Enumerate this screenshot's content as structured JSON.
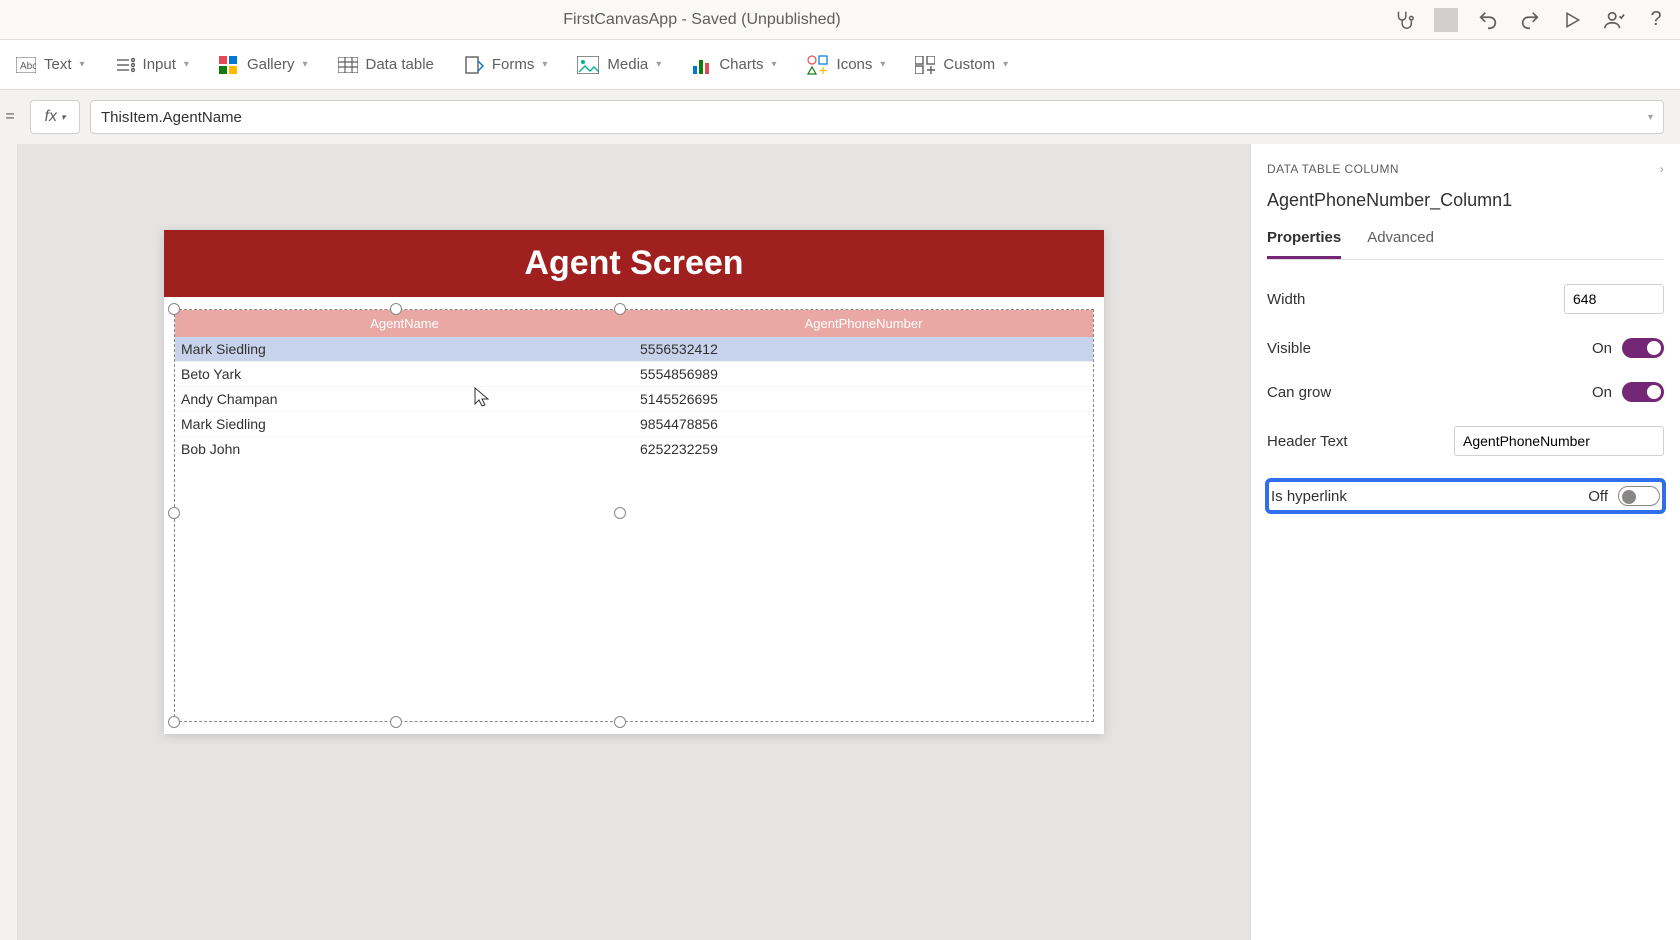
{
  "titlebar": {
    "app_title": "FirstCanvasApp - Saved (Unpublished)"
  },
  "ribbon": {
    "text": "Text",
    "input": "Input",
    "gallery": "Gallery",
    "data_table": "Data table",
    "forms": "Forms",
    "media": "Media",
    "charts": "Charts",
    "icons": "Icons",
    "custom": "Custom"
  },
  "formula": {
    "value": "ThisItem.AgentName"
  },
  "screen": {
    "title": "Agent Screen",
    "col1": "AgentName",
    "col2": "AgentPhoneNumber",
    "rows": [
      {
        "name": "Mark Siedling",
        "phone": "5556532412"
      },
      {
        "name": "Beto Yark",
        "phone": "5554856989"
      },
      {
        "name": "Andy Champan",
        "phone": "5145526695"
      },
      {
        "name": "Mark Siedling",
        "phone": "9854478856"
      },
      {
        "name": "Bob John",
        "phone": "6252232259"
      }
    ]
  },
  "right_pane": {
    "kicker": "DATA TABLE COLUMN",
    "title": "AgentPhoneNumber_Column1",
    "tab_props": "Properties",
    "tab_adv": "Advanced",
    "labels": {
      "width": "Width",
      "visible": "Visible",
      "can_grow": "Can grow",
      "header_text": "Header Text",
      "is_hyperlink": "Is hyperlink"
    },
    "values": {
      "width": "648",
      "visible": "On",
      "can_grow": "On",
      "header_text": "AgentPhoneNumber",
      "is_hyperlink": "Off"
    }
  }
}
